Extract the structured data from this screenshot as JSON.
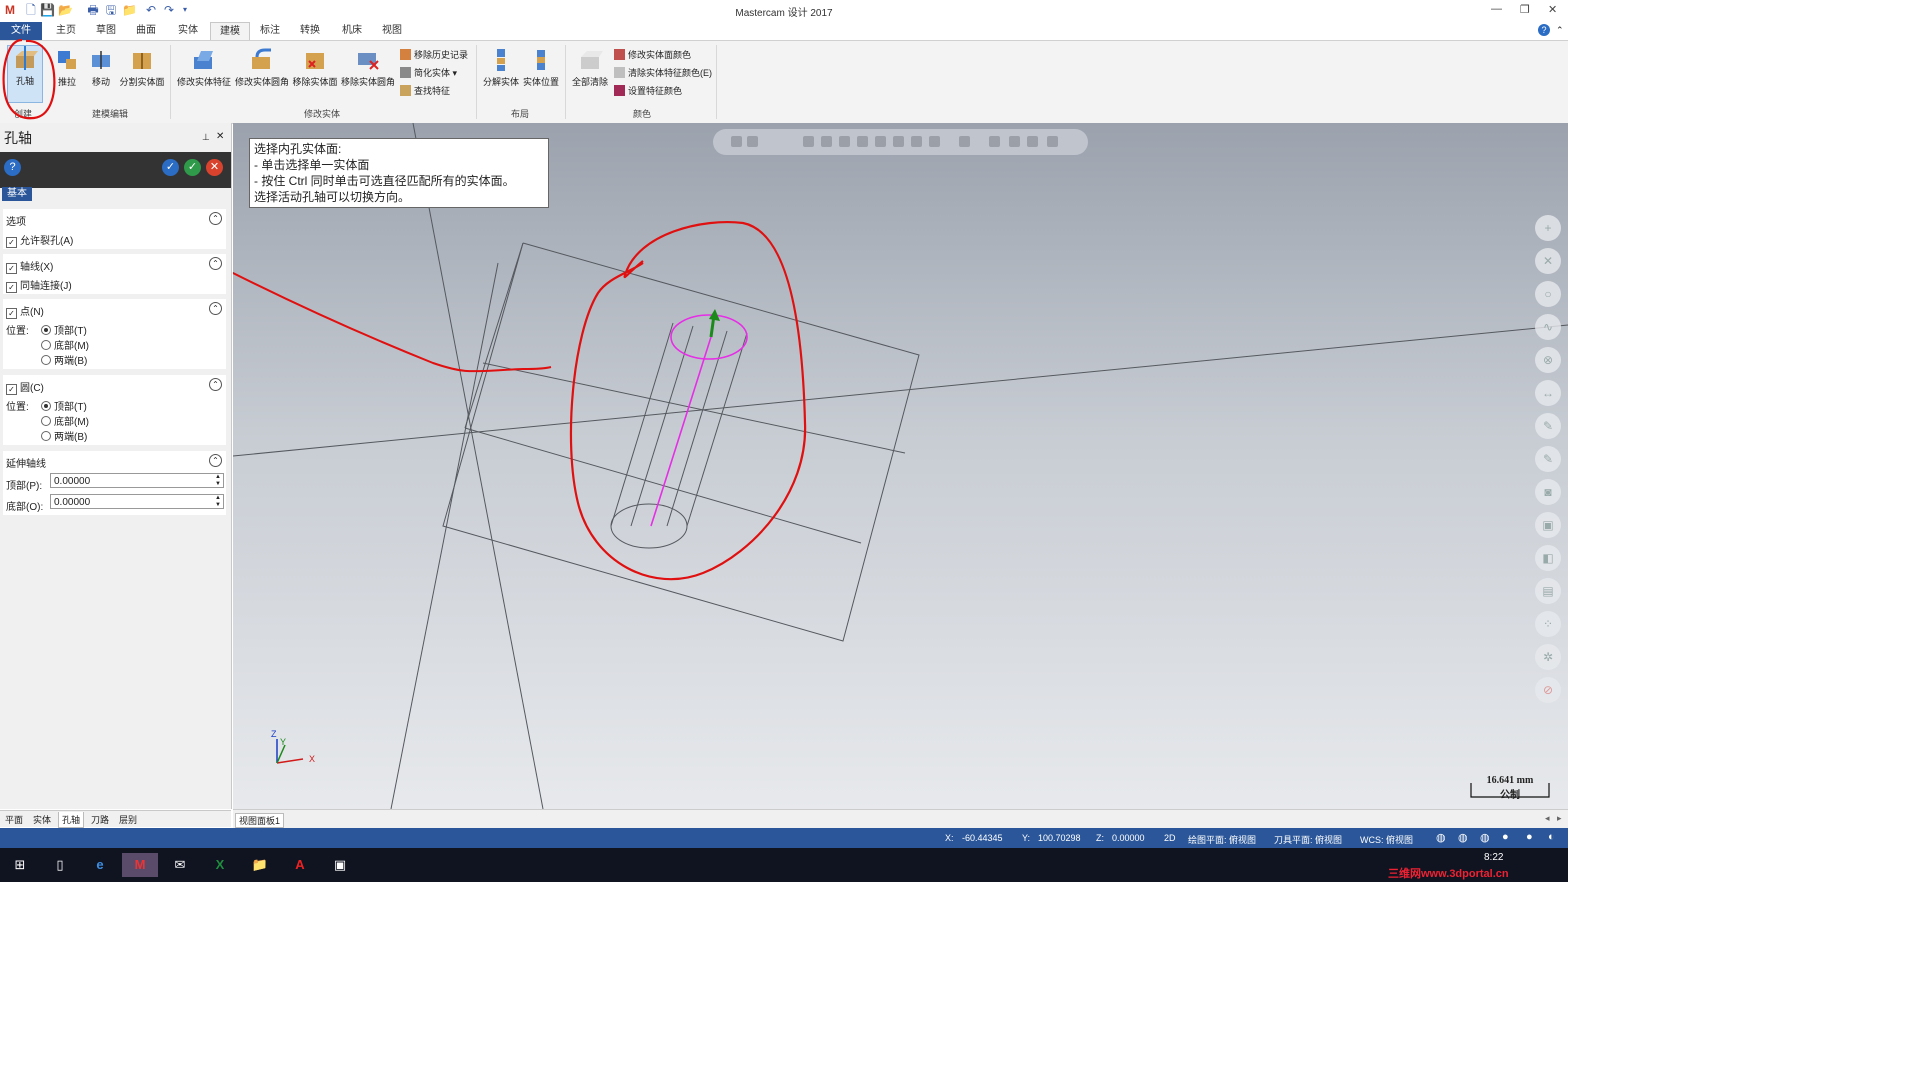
{
  "window": {
    "title": "Mastercam 设计 2017"
  },
  "tabs": [
    "文件",
    "主页",
    "草图",
    "曲面",
    "实体",
    "建模",
    "标注",
    "转换",
    "机床",
    "视图"
  ],
  "ribbon": {
    "buttons": [
      "孔轴",
      "推拉",
      "移动",
      "分割实体面",
      "修改实体特征",
      "修改实体圆角",
      "移除实体面",
      "移除实体圆角",
      "分解实体",
      "实体位置",
      "全部清除"
    ],
    "small_items": [
      "移除历史记录",
      "简化实体",
      "查找特征",
      "修改实体面颜色",
      "清除实体特征颜色(E)",
      "设置特征颜色"
    ],
    "groups": [
      "创建",
      "建模编辑",
      "修改实体",
      "布局",
      "颜色"
    ]
  },
  "panel": {
    "title": "孔轴",
    "basic_tab": "基本",
    "options_header": "选项",
    "allow_split": "允许裂孔(A)",
    "axis_line": "轴线(X)",
    "coaxial": "同轴连接(J)",
    "point": "点(N)",
    "position_label": "位置:",
    "top": "顶部(T)",
    "middle": "底部(M)",
    "both": "两端(B)",
    "circle": "圆(C)",
    "extend_header": "延伸轴线",
    "top_label": "顶部(P):",
    "top_value": "0.00000",
    "bottom_label": "底部(O):",
    "bottom_value": "0.00000",
    "bottom_tabs": [
      "平面",
      "实体",
      "孔轴",
      "刀路",
      "层别"
    ]
  },
  "viewport": {
    "tooltip": [
      "选择内孔实体面:",
      "- 单击选择单一实体面",
      "- 按住 Ctrl 同时单击可选直径匹配所有的实体面。",
      "选择活动孔轴可以切换方向。"
    ],
    "scale_value": "16.641 mm",
    "scale_unit": "公制",
    "tab": "视图面板1"
  },
  "status": {
    "x_label": "X:",
    "x": "-60.44345",
    "y_label": "Y:",
    "y": "100.70298",
    "z_label": "Z:",
    "z": "0.00000",
    "mode": "2D",
    "plane": "绘图平面: 俯视图",
    "tool_plane": "刀具平面: 俯视图",
    "wcs": "WCS: 俯视图"
  },
  "taskbar": {
    "time": "8:22"
  },
  "watermark": "三维网www.3dportal.cn"
}
